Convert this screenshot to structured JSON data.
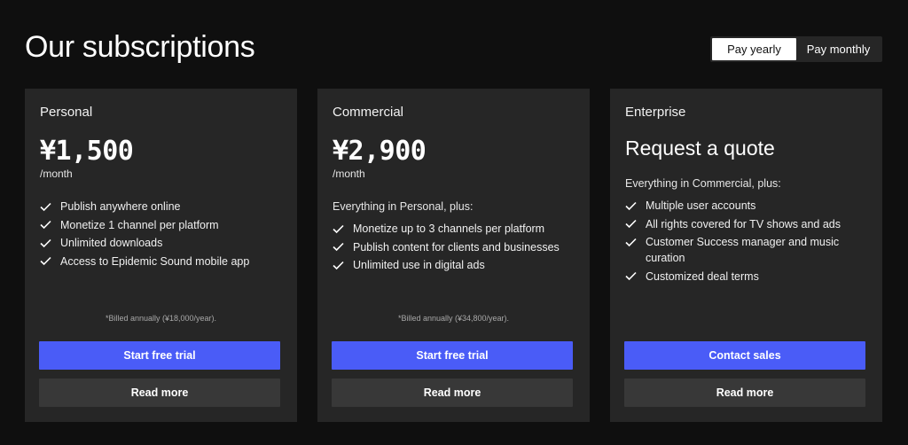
{
  "page": {
    "title": "Our subscriptions"
  },
  "billing_toggle": {
    "yearly": "Pay yearly",
    "monthly": "Pay monthly",
    "selected": "yearly"
  },
  "colors": {
    "background": "#0f0f0f",
    "card": "#262626",
    "primary_button": "#4a5cf7",
    "secondary_button": "#383838"
  },
  "plans": [
    {
      "name": "Personal",
      "price": "¥1,500",
      "period": "/month",
      "features": [
        "Publish anywhere online",
        "Monetize 1 channel per platform",
        "Unlimited downloads",
        "Access to Epidemic Sound mobile app"
      ],
      "note": "*Billed annually (¥18,000/year).",
      "primary_cta": "Start free trial",
      "secondary_cta": "Read more"
    },
    {
      "name": "Commercial",
      "price": "¥2,900",
      "period": "/month",
      "intro": "Everything in Personal, plus:",
      "features": [
        "Monetize up to 3 channels per platform",
        "Publish content for clients and businesses",
        "Unlimited use in digital ads"
      ],
      "note": "*Billed annually (¥34,800/year).",
      "primary_cta": "Start free trial",
      "secondary_cta": "Read more"
    },
    {
      "name": "Enterprise",
      "headline": "Request a quote",
      "intro": "Everything in Commercial, plus:",
      "features": [
        "Multiple user accounts",
        "All rights covered for TV shows and ads",
        "Customer Success manager and music curation",
        "Customized deal terms"
      ],
      "primary_cta": "Contact sales",
      "secondary_cta": "Read more"
    }
  ]
}
